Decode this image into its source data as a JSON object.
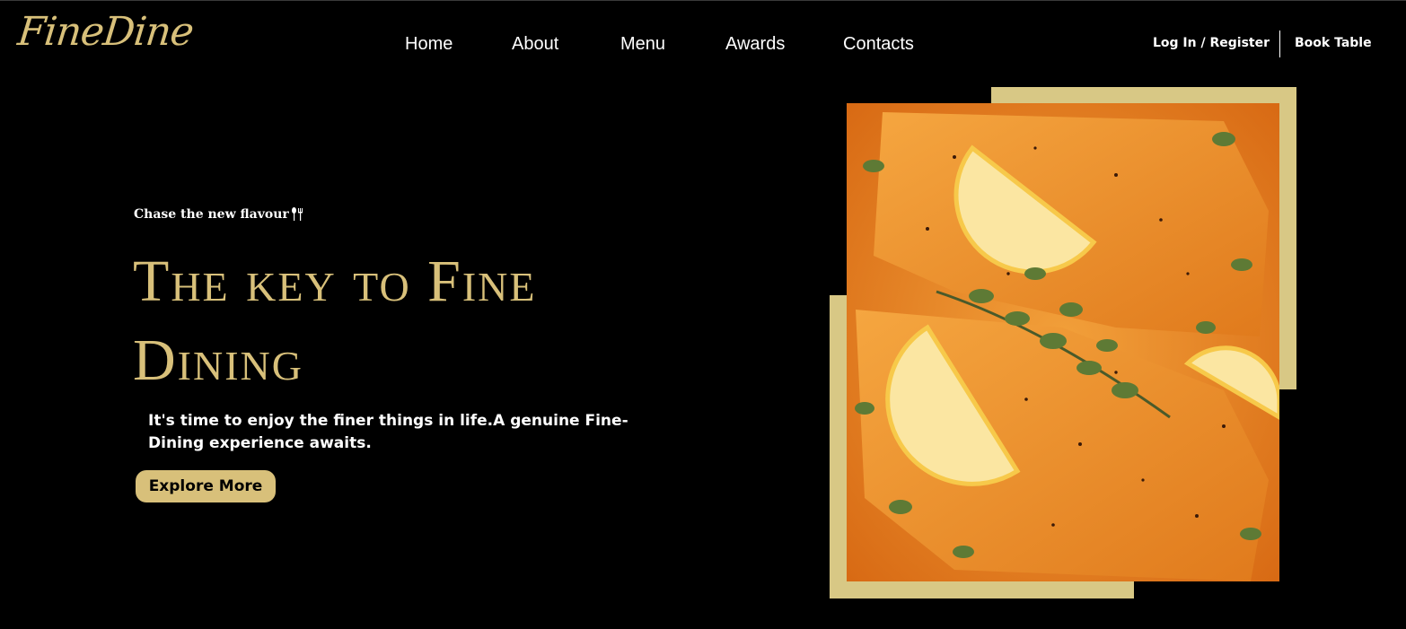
{
  "header": {
    "logo": "FineDine",
    "nav": [
      {
        "label": "Home"
      },
      {
        "label": "About"
      },
      {
        "label": "Menu"
      },
      {
        "label": "Awards"
      },
      {
        "label": "Contacts"
      }
    ],
    "auth_label": "Log In / Register",
    "book_label": "Book Table"
  },
  "hero": {
    "tagline": "Chase the new flavour",
    "tagline_icon": "cutlery-icon",
    "headline": "The key to Fine Dining",
    "description": "It's time to enjoy the finer things in life.A genuine Fine- Dining experience awaits.",
    "cta_label": "Explore More",
    "image": "salmon-with-lemon-and-herbs"
  },
  "colors": {
    "background": "#000000",
    "accent_gold": "#d8c07a",
    "frame_gold": "#d8c885",
    "text": "#ffffff"
  }
}
